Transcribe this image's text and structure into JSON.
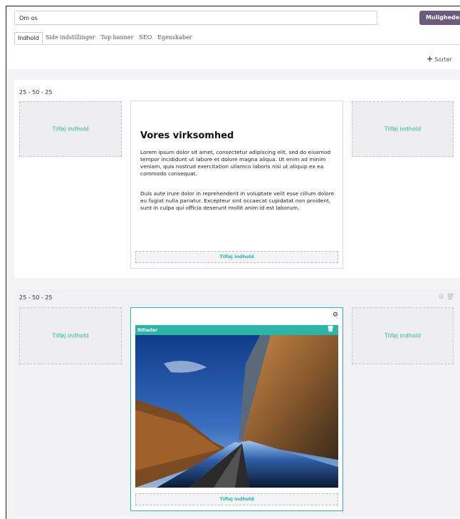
{
  "page": {
    "name_value": "Om os"
  },
  "toolbar": {
    "options_label": "Muligheder -"
  },
  "tabs": [
    {
      "label": "Indhold"
    },
    {
      "label": "Side indstillinger"
    },
    {
      "label": "Top banner"
    },
    {
      "label": "SEO"
    },
    {
      "label": "Egenskaber"
    }
  ],
  "sort_label": "Sorter",
  "sections": [
    {
      "label": "25 - 50 - 25",
      "left_add": "Tilføj indhold",
      "right_add": "Tilføj indhold",
      "center": {
        "heading": "Vores virksomhed",
        "paragraphs": [
          "Lorem ipsum dolor sit amet, consectetur adipiscing elit, sed do eiusmod tempor incididunt ut labore et dolore magna aliqua. Ut enim ad minim veniam, quis nostrud exercitation ullamco laboris nisi ut aliquip ex ea commodo consequat.",
          "Duis aute irure dolor in reprehenderit in voluptate velit esse cillum dolore eu fugiat nulla pariatur. Excepteur sint occaecat cupidatat non proident, sunt in culpa qui officia deserunt mollit anim id est laborum."
        ],
        "add": "Tilføj indhold"
      }
    },
    {
      "label": "25 - 50 - 25",
      "left_add": "Tilføj indhold",
      "right_add": "Tilføj indhold",
      "center": {
        "widget_title": "Billeder",
        "add": "Tilføj indhold"
      }
    }
  ],
  "colors": {
    "accent": "#2bb5a6",
    "options_button": "#6c5b7b"
  },
  "icons": [
    "plus-icon",
    "gear-icon",
    "trash-icon"
  ]
}
